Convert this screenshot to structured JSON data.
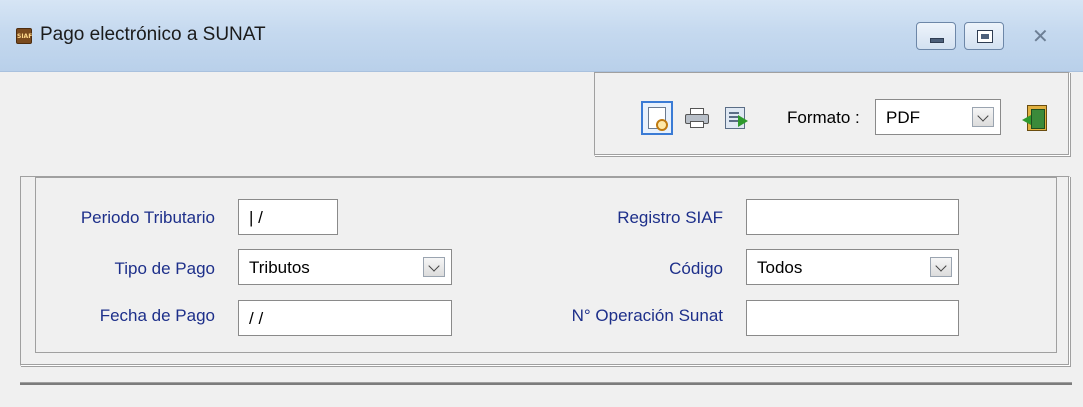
{
  "window": {
    "title": "Pago electrónico a SUNAT",
    "app_icon_text": "SIAF"
  },
  "toolbar": {
    "formato_label": "Formato :",
    "formato_value": "PDF"
  },
  "form": {
    "periodo_tributario": {
      "label": "Periodo Tributario",
      "value": "| /"
    },
    "tipo_pago": {
      "label": "Tipo de Pago",
      "value": "Tributos"
    },
    "fecha_pago": {
      "label": "Fecha de Pago",
      "value": "/ /"
    },
    "registro_siaf": {
      "label": "Registro SIAF",
      "value": ""
    },
    "codigo": {
      "label": "Código",
      "value": "Todos"
    },
    "operacion_sunat": {
      "label": "N° Operación Sunat",
      "value": ""
    }
  }
}
